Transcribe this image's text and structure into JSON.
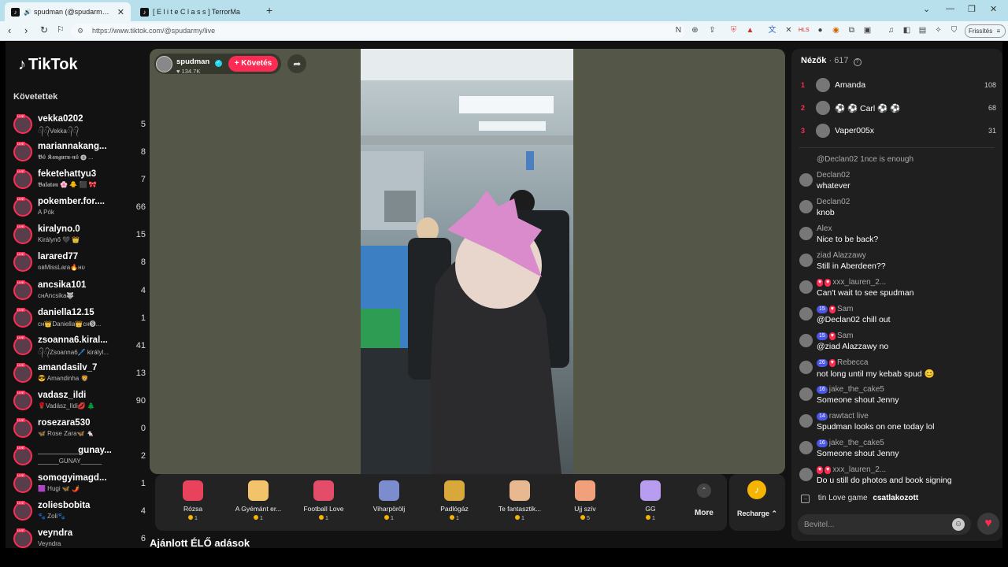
{
  "browser": {
    "tabs": [
      {
        "title": "spudman (@spudarmy) ÉLŐ a",
        "icon": "tiktok-icon",
        "active": true
      },
      {
        "title": "[ E l i t e   C l a s s ] TerrorMa",
        "icon": "tiktok-icon",
        "active": false
      }
    ],
    "new_tab": "+",
    "url": "https://www.tiktok.com/@spudarmy/live",
    "refresh_label": "Frissítés"
  },
  "sidebar": {
    "logo": "TikTok",
    "following_title": "Követettek",
    "items": [
      {
        "name": "vekka0202",
        "sub": "᭄᭄Vekka᭄᭄",
        "count": "5"
      },
      {
        "name": "mariannakang...",
        "sub": "𝕭é 𝕶𝖆𝖓𝖌𝖚𝖗𝖚-𝖓é 🅢 ...",
        "count": "8"
      },
      {
        "name": "feketehattyu3",
        "sub": "𝕭𝖆𝖑𝖆𝖙𝖔𝖓 🌸 🐥 ⬛ 🎀",
        "count": "7"
      },
      {
        "name": "pokember.for....",
        "sub": "A Pók",
        "count": "66"
      },
      {
        "name": "kiralyno.0",
        "sub": "Királynő 🖤 👑",
        "count": "15"
      },
      {
        "name": "larared77",
        "sub": "ɢʙMissLara🔥ʜᴜ",
        "count": "8"
      },
      {
        "name": "ancsika101",
        "sub": "ᴄʜAncsika🐺",
        "count": "4"
      },
      {
        "name": "daniella12.15",
        "sub": "ᴄʜ👑Daniella👑ᴄʜ🅢...",
        "count": "1"
      },
      {
        "name": "zsoanna6.kiral...",
        "sub": "᭄᭄Zsoanna6🖊️ királyl...",
        "count": "41"
      },
      {
        "name": "amandasilv_7",
        "sub": "😎 Amandinha 🦁",
        "count": "13"
      },
      {
        "name": "vadasz_ildi",
        "sub": "🌹Vadász_Ildi💋 🌲",
        "count": "90"
      },
      {
        "name": "rosezara530",
        "sub": "🦋 Rose Zara🦋 🐁",
        "count": "0"
      },
      {
        "name": "________gunay...",
        "sub": "______GUNAY______",
        "count": "2"
      },
      {
        "name": "somogyimagd...",
        "sub": "🟪 Hugi 🦋 🌶️",
        "count": "1"
      },
      {
        "name": "zoliesbobita",
        "sub": "🐾 Zoli🐾",
        "count": "4"
      },
      {
        "name": "veyndra",
        "sub": "Veyndra",
        "count": "6"
      }
    ]
  },
  "stream": {
    "host_name": "spudman",
    "host_likes": "134.7K",
    "follow_label": "+ Követés",
    "recommended_title": "Ajánlott ÉLŐ adások"
  },
  "gifts": [
    {
      "name": "Rózsa",
      "price": "1",
      "color": "#e8425c"
    },
    {
      "name": "A Gyémánt er...",
      "price": "1",
      "color": "#f2c36b"
    },
    {
      "name": "Football Love",
      "price": "1",
      "color": "#e44d6a"
    },
    {
      "name": "Viharpörölj",
      "price": "1",
      "color": "#7b8ccf"
    },
    {
      "name": "Padlógáz",
      "price": "1",
      "color": "#d9a83a"
    },
    {
      "name": "Te fantasztik...",
      "price": "1",
      "color": "#e8b890"
    },
    {
      "name": "Ujj szív",
      "price": "5",
      "color": "#f0a07a"
    },
    {
      "name": "GG",
      "price": "1",
      "color": "#b89cf0"
    }
  ],
  "more_label": "More",
  "recharge_label": "Recharge",
  "viewers": {
    "title": "Nézők",
    "count": "· 617",
    "top": [
      {
        "rank": "1",
        "name": "Amanda",
        "score": "108"
      },
      {
        "rank": "2",
        "name": "⚽ ⚽ Carl ⚽ ⚽",
        "score": "68"
      },
      {
        "rank": "3",
        "name": "Vaper005x",
        "score": "31"
      }
    ]
  },
  "chat": [
    {
      "user": "@Declan02",
      "text": "1nce is enough",
      "badges": [],
      "partial": true
    },
    {
      "user": "Declan02",
      "text": "whatever",
      "badges": []
    },
    {
      "user": "Declan02",
      "text": "knob",
      "badges": []
    },
    {
      "user": "Alex",
      "text": "Nice to be back?",
      "badges": []
    },
    {
      "user": "ziad Alazzawy",
      "text": "Still in Aberdeen??",
      "badges": []
    },
    {
      "user": "xxx_lauren_2...",
      "text": "Can't wait to see spudman",
      "badges": [
        "♥",
        "♥"
      ]
    },
    {
      "user": "Sam",
      "text": "@Declan02 chill out",
      "badges": [
        "15",
        "♥"
      ]
    },
    {
      "user": "Sam",
      "text": "@ziad Alazzawy no",
      "badges": [
        "15",
        "♥"
      ]
    },
    {
      "user": "Rebecca",
      "text": "not long until my kebab spud 😊",
      "badges": [
        "26",
        "♥"
      ]
    },
    {
      "user": "jake_the_cake5",
      "text": "Someone shout Jenny",
      "badges": [
        "16"
      ]
    },
    {
      "user": "rawtact live",
      "text": "Spudman looks on one today lol",
      "badges": [
        "14"
      ]
    },
    {
      "user": "jake_the_cake5",
      "text": "Someone shout Jenny",
      "badges": [
        "16"
      ]
    },
    {
      "user": "xxx_lauren_2...",
      "text": "Do u still do photos and book signing",
      "badges": [
        "♥",
        "♥"
      ]
    }
  ],
  "joined": {
    "user": "tin Love game",
    "text": "csatlakozott"
  },
  "chat_input": {
    "placeholder": "Bevitel..."
  }
}
